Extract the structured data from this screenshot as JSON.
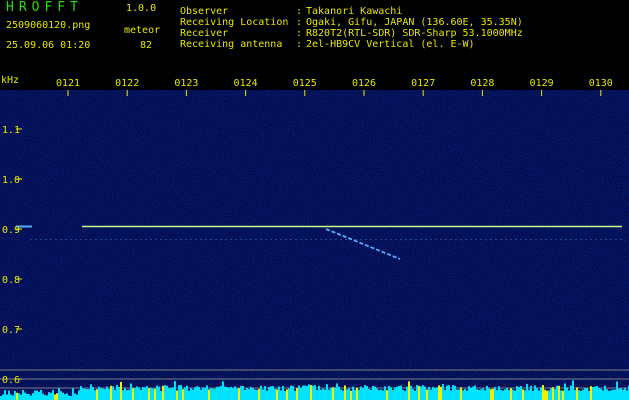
{
  "app": {
    "name": "HROFFT",
    "version": "1.0.0"
  },
  "file": {
    "name": "2509060120.png",
    "datetime": "25.09.06 01:20"
  },
  "detection": {
    "label": "meteor",
    "count": "82"
  },
  "info": [
    {
      "key": "Observer",
      "value": "Takanori Kawachi"
    },
    {
      "key": "Receiving Location",
      "value": "Ogaki, Gifu, JAPAN (136.60E, 35.35N)"
    },
    {
      "key": "Receiver",
      "value": "R820T2(RTL-SDR) SDR-Sharp 53.1000MHz"
    },
    {
      "key": "Receiving antenna",
      "value": "2el-HB9CV Vertical (el. E-W)"
    }
  ],
  "spectrogram": {
    "unit": "kHz",
    "time_labels": [
      "0121",
      "0122",
      "0123",
      "0124",
      "0125",
      "0126",
      "0127",
      "0128",
      "0129",
      "0130"
    ],
    "freq_labels": [
      {
        "text": "1.1",
        "value": 1.1
      },
      {
        "text": "1.0",
        "value": 1.0
      },
      {
        "text": "0.9",
        "value": 0.9
      },
      {
        "text": "0.8",
        "value": 0.8
      },
      {
        "text": "0.7",
        "value": 0.7
      },
      {
        "text": "0.6",
        "value": 0.6
      }
    ],
    "carrier_khz": 0.905,
    "meteor_trail": {
      "start_khz": 0.9,
      "end_khz": 0.84
    },
    "colors": {
      "background": "#0a0a6a",
      "carrier": "#c8ff80",
      "trail": "#50b0ff",
      "labels": "#e8e800",
      "noise_bar": "#00e0ff"
    }
  }
}
